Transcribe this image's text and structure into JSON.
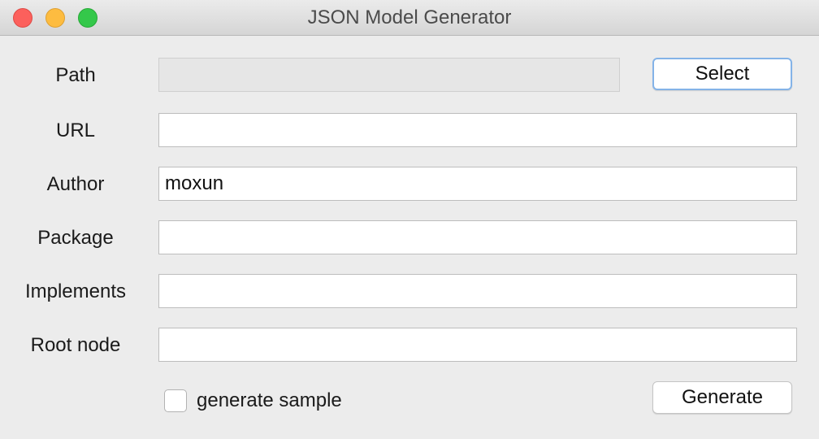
{
  "window": {
    "title": "JSON Model Generator"
  },
  "form": {
    "path": {
      "label": "Path",
      "value": ""
    },
    "select_button": "Select",
    "url": {
      "label": "URL",
      "value": ""
    },
    "author": {
      "label": "Author",
      "value": "moxun"
    },
    "package": {
      "label": "Package",
      "value": ""
    },
    "implements": {
      "label": "Implements",
      "value": ""
    },
    "root_node": {
      "label": "Root node",
      "value": ""
    },
    "generate_sample": {
      "label": "generate sample",
      "checked": false
    },
    "generate_button": "Generate"
  }
}
